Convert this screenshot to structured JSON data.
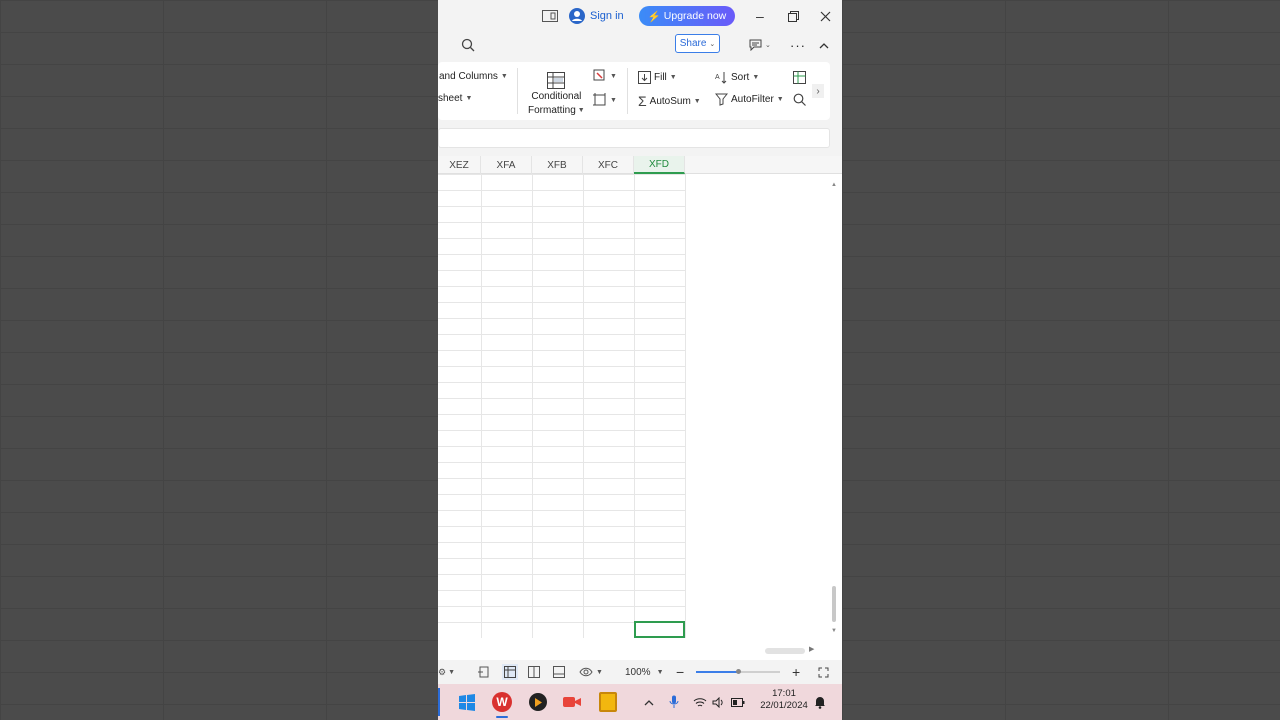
{
  "titlebar": {
    "sign_in": "Sign in",
    "upgrade": "Upgrade now"
  },
  "toolbar": {
    "share": "Share"
  },
  "ribbon": {
    "rows_and_columns": "and Columns",
    "worksheet": "sheet",
    "conditional_formatting_line1": "Conditional",
    "conditional_formatting_line2": "Formatting",
    "fill": "Fill",
    "sort": "Sort",
    "autosum": "AutoSum",
    "autofilter": "AutoFilter"
  },
  "columns": [
    "XEZ",
    "XFA",
    "XFB",
    "XFC",
    "XFD"
  ],
  "selected_column": "XFD",
  "status": {
    "zoom": "100%"
  },
  "taskbar": {
    "time": "17:01",
    "date": "22/01/2024"
  },
  "colors": {
    "accent_green": "#2e9c4f",
    "upgrade_start": "#3b8cf7",
    "upgrade_end": "#6a5af9"
  }
}
